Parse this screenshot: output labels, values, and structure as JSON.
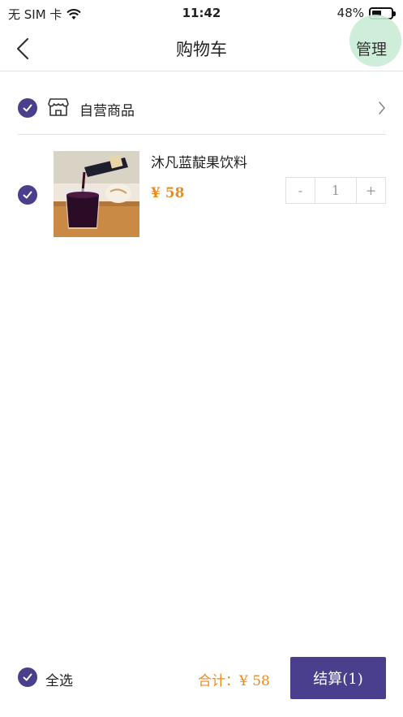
{
  "status_bar": {
    "carrier": "无 SIM 卡",
    "time": "11:42",
    "battery_percent": "48%",
    "battery_level": 0.48
  },
  "header": {
    "title": "购物车",
    "manage_label": "管理"
  },
  "shop": {
    "name": "自营商品"
  },
  "items": [
    {
      "name": "沐凡蓝靛果饮料",
      "price": "¥ 58",
      "quantity": "1",
      "minus_label": "-",
      "plus_label": "+"
    }
  ],
  "footer": {
    "select_all_label": "全选",
    "total": "合计：¥ 58",
    "checkout_label": "结算(1)"
  },
  "colors": {
    "accent": "#4a3f8c",
    "price": "#f08a1a"
  }
}
